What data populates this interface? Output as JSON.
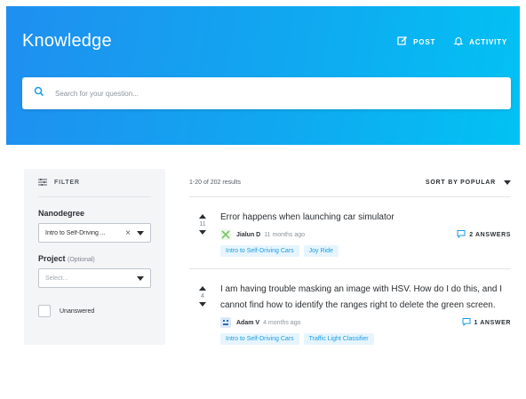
{
  "header": {
    "brand": "Knowledge",
    "post_label": "POST",
    "activity_label": "ACTIVITY"
  },
  "search": {
    "placeholder": "Search for your question..."
  },
  "sidebar": {
    "filter_label": "FILTER",
    "nanodegree_label": "Nanodegree",
    "nanodegree_value": "Intro to Self-Driving ...",
    "project_label": "Project",
    "project_optional": "(Optional)",
    "project_placeholder": "Select...",
    "unanswered_label": "Unanswered"
  },
  "results": {
    "count_text": "1-20 of 202 results",
    "sort_label": "SORT BY POPULAR",
    "questions": [
      {
        "votes": "11",
        "title": "Error happens when launching car simulator",
        "author": "Jialun D",
        "time": "11 months ago",
        "answers": "2 ANSWERS",
        "tags": [
          "Intro to Self-Driving Cars",
          "Joy Ride"
        ]
      },
      {
        "votes": "4",
        "title": "I am having trouble masking an image with HSV. How do I do this, and I cannot find how to identify the ranges right to delete the green screen.",
        "author": "Adam V",
        "time": "4 months ago",
        "answers": "1 ANSWER",
        "tags": [
          "Intro to Self-Driving Cars",
          "Traffic Light Classifier"
        ]
      }
    ]
  },
  "colors": {
    "header_start": "#1f8ff0",
    "header_end": "#02c2f3",
    "accent": "#02b3e4",
    "tag_text": "#1a9be6",
    "tag_bg": "#e6f5fd"
  },
  "icons": [
    "pencil-icon",
    "bell-icon",
    "search-icon",
    "filter-icon",
    "chat-bubble-icon",
    "avatar-icon"
  ]
}
